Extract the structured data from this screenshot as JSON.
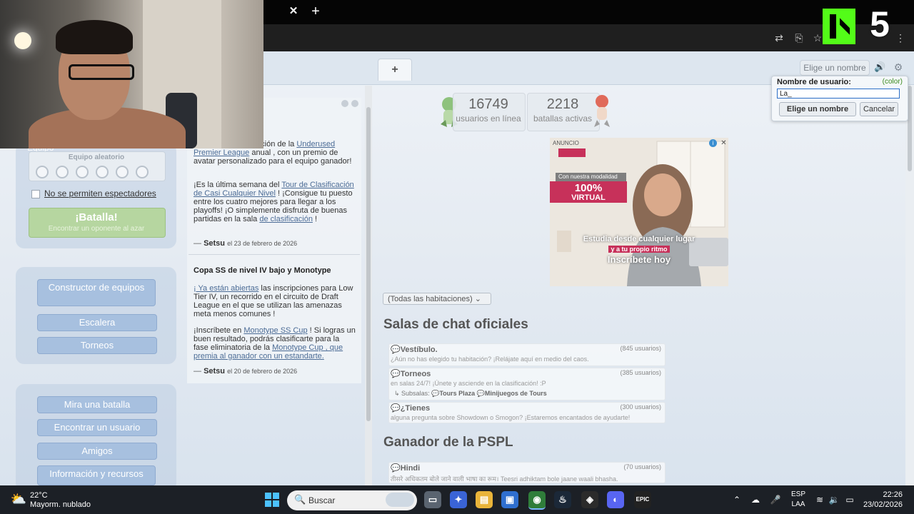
{
  "browser": {
    "tab_close": "✕",
    "new_tab": "+",
    "overlay_number": "5"
  },
  "header": {
    "add_room": "+",
    "choose_name": "Elige un nombre"
  },
  "left": {
    "team_label": "Equipo",
    "team_random": "Equipo aleatorio",
    "no_spectators": "No se permiten espectadores",
    "battle_title": "¡Batalla!",
    "battle_sub": "Encontrar un oponente al azar",
    "team_builder": "Constructor de equipos",
    "ladder": "Escalera",
    "tournaments": "Torneos",
    "watch_battle": "Mira una batalla",
    "find_user": "Encontrar un usuario",
    "friends": "Amigos",
    "info": "Información y recursos"
  },
  "news": {
    "n1_p1_pre": "articipar en otra edición de la ",
    "n1_p1_link": "Underused Premier League",
    "n1_p1_post": " anual , con un premio de avatar personalizado para el equipo ganador!",
    "n1_p2_pre": "¡Es la última semana del ",
    "n1_p2_link": "Tour de Clasificación de Casi Cualquier Nivel",
    "n1_p2_mid": " ! ¡Consigue tu puesto entre los cuatro mejores para llegar a los playoffs! ¡O simplemente disfruta de buenas partidas en la sala ",
    "n1_p2_link2": "de clasificación",
    "n1_p2_post": " !",
    "n1_author": "Setsu",
    "n1_date": "el 23 de febrero de 2026",
    "n2_title": "Copa SS de nivel IV bajo y Monotype",
    "n2_p1_link": "¡ Ya están abiertas",
    "n2_p1_post": " las inscripciones para Low Tier IV, un recorrido en el circuito de Draft League en el que se utilizan las amenazas meta menos comunes !",
    "n2_p2_pre": "¡Inscríbete en ",
    "n2_p2_link": "Monotype SS Cup",
    "n2_p2_mid": " ! Si logras un buen resultado, podrás clasificarte para la fase eliminatoria de la ",
    "n2_p2_link2": "Monotype Cup , que premia al ganador con un estandarte.",
    "n2_author": "Setsu",
    "n2_date": "el 20 de febrero de 2026"
  },
  "stats": {
    "users_num": "16749",
    "users_label": "usuarios en línea",
    "battles_num": "2218",
    "battles_label": "batallas activas"
  },
  "ad": {
    "label": "ANUNCIO",
    "info": "i",
    "close": "✕",
    "pill": "Con nuestra modalidad",
    "pct": "100%",
    "virtual": "VIRTUAL",
    "line1": "Estudia desde cualquier lugar",
    "line2": "y a tu propio ritmo",
    "cta": "Inscríbete hoy"
  },
  "rooms": {
    "filter": "(Todas las habitaciones)",
    "official_title": "Salas de chat oficiales",
    "r1_name": "Vestíbulo.",
    "r1_count": "(845 usuarios)",
    "r1_desc": "¿Aún no has elegido tu habitación? ¡Relájate aquí en medio del caos.",
    "r2_name": "Torneos",
    "r2_count": "(385 usuarios)",
    "r2_desc": "en salas 24/7! ¡Únete y asciende en la clasificación! :P",
    "r2_sub_label": "Subsalas:",
    "r2_sub1": "Tours Plaza",
    "r2_sub2": "Minijuegos de Tours",
    "r3_name": "¿Tienes",
    "r3_count": "(300 usuarios)",
    "r3_desc": "alguna pregunta sobre Showdown o Smogon? ¡Estaremos encantados de ayudarte!",
    "pspl_title": "Ganador de la PSPL",
    "r4_name": "Hindi",
    "r4_count": "(70 usuarios)",
    "r4_desc": "तीसरे अधिकतम बोले जाने वाली भाषा का रूम। Teesri adhiktam bole jaane waali bhasha."
  },
  "popup": {
    "label": "Nombre de usuario:",
    "color": "(color)",
    "input_value": "La_",
    "confirm": "Elige un nombre",
    "cancel": "Cancelar"
  },
  "taskbar": {
    "temp": "22°C",
    "weather": "Mayorm. nublado",
    "search": "Buscar",
    "lang1": "ESP",
    "lang2": "LAA",
    "time": "22:26",
    "date": "23/02/2026"
  },
  "colors": {
    "accent": "#53fc18",
    "battle_button": "#b6d6a0",
    "menu_button": "#a7c0df",
    "ad_brand": "#c7315a"
  }
}
